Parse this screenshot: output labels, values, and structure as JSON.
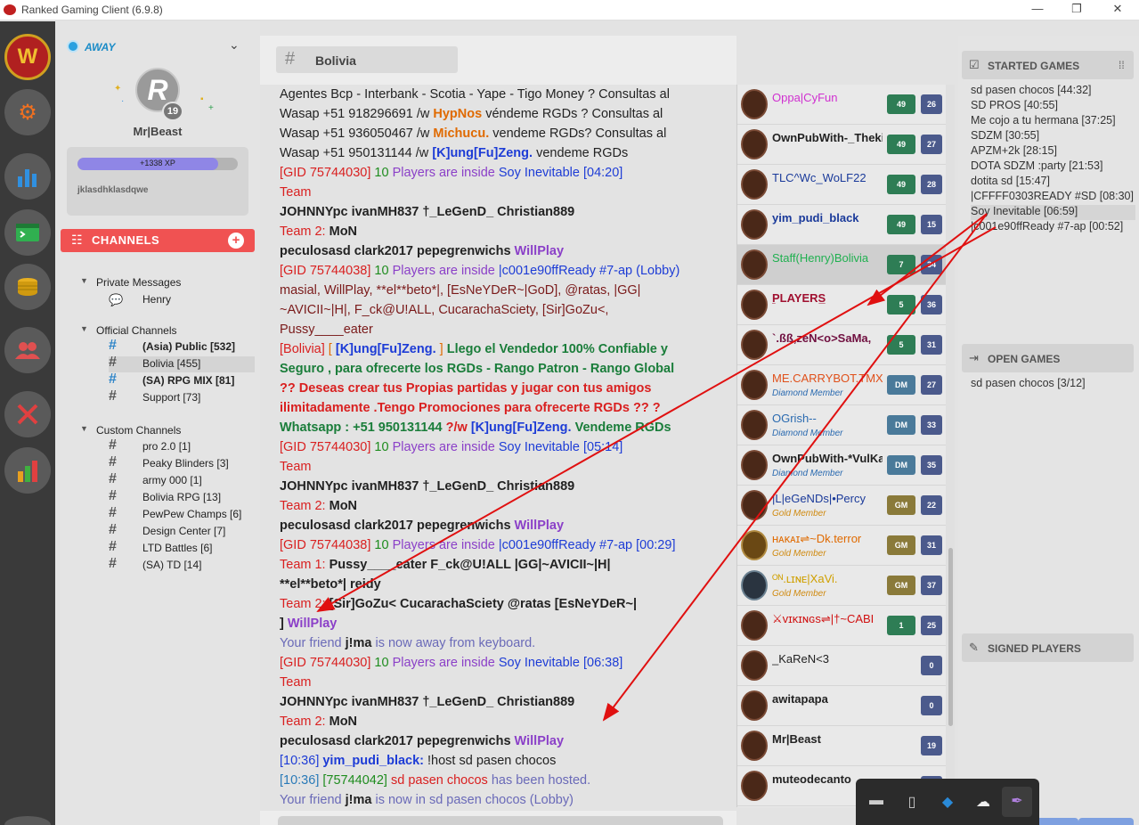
{
  "window": {
    "title": "Ranked Gaming Client (6.9.8)",
    "controls": [
      "—",
      "❐",
      "✕"
    ]
  },
  "rail": {
    "items": [
      {
        "name": "warcraft-logo",
        "glyph": "W"
      },
      {
        "name": "settings",
        "glyph": "⚙"
      },
      {
        "name": "stats",
        "glyph": "▮"
      },
      {
        "name": "console",
        "glyph": "▣"
      },
      {
        "name": "coins",
        "glyph": "◉"
      },
      {
        "name": "friends",
        "glyph": "👥"
      },
      {
        "name": "battle",
        "glyph": "⚔"
      },
      {
        "name": "ladder",
        "glyph": "▮"
      }
    ]
  },
  "profile": {
    "status": "AWAY",
    "avatar_letter": "R",
    "level": "19",
    "username": "Mr|Beast",
    "xp_label": "+1338 XP",
    "xp_progress": 0.88,
    "note": "jklasdhklasdqwe"
  },
  "channels": {
    "header": "CHANNELS",
    "groups": [
      {
        "label": "Private Messages",
        "items": [
          {
            "label": "Henry",
            "icon": "chat-bubble-icon"
          }
        ]
      },
      {
        "label": "Official Channels",
        "items": [
          {
            "label": "(Asia) Public [532]",
            "bold": true
          },
          {
            "label": "Bolivia [455]",
            "selected": true
          },
          {
            "label": "(SA) RPG MIX [81]",
            "bold": true
          },
          {
            "label": "Support [73]"
          }
        ]
      },
      {
        "label": "Custom Channels",
        "items": [
          {
            "label": "pro 2.0 [1]"
          },
          {
            "label": "Peaky Blinders [3]"
          },
          {
            "label": "army 000 [1]"
          },
          {
            "label": "Bolivia RPG [13]"
          },
          {
            "label": "PewPew Champs [6]"
          },
          {
            "label": "Design Center [7]"
          },
          {
            "label": "LTD Battles [6]"
          },
          {
            "label": "(SA) TD [14]"
          }
        ]
      }
    ]
  },
  "chat": {
    "tab": "Bolivia",
    "lines": [
      [
        [
          "bk",
          "",
          "Agentes Bcp - Interbank - Scotia - Yape - Tigo Money ? Consultas al"
        ]
      ],
      [
        [
          "bk",
          "",
          "Wasap +51 918296691 /w "
        ],
        [
          "or",
          "b",
          "HypNos"
        ],
        [
          "bk",
          "",
          " véndeme RGDs ? Consultas al"
        ]
      ],
      [
        [
          "bk",
          "",
          "Wasap +51 936050467 /w "
        ],
        [
          "or",
          "b",
          "Michucu."
        ],
        [
          "bk",
          "",
          " vendeme RGDs? Consultas al"
        ]
      ],
      [
        [
          "bk",
          "",
          "Wasap +51 950131144 /w "
        ],
        [
          "bl",
          "b",
          "[K]ung[Fu]Zeng."
        ],
        [
          "bk",
          "",
          " vendeme RGDs"
        ]
      ],
      [
        [
          "rd",
          "",
          "[GID 75744030]"
        ],
        [
          "gr",
          "",
          " 10"
        ],
        [
          "pu",
          "",
          " Players are inside"
        ],
        [
          "bl",
          "",
          " Soy Inevitable [04:20]"
        ]
      ],
      [
        [
          "rd",
          "",
          "Team"
        ]
      ],
      [
        [
          "bk",
          "b",
          "   JOHNNYpc    ivanMH837    †_LeGenD_    Christian889"
        ]
      ],
      [
        [
          "rd",
          "",
          "Team 2:"
        ],
        [
          "bk",
          "b",
          "   MoN"
        ]
      ],
      [
        [
          "bk",
          "b",
          "peculosasd   clark2017   pepegrenwichs"
        ],
        [
          "pu",
          "b",
          "   WillPlay"
        ]
      ],
      [
        [
          "rd",
          "",
          "[GID 75744038]"
        ],
        [
          "gr",
          "",
          " 10"
        ],
        [
          "pu",
          "",
          " Players are inside"
        ],
        [
          "bl",
          "",
          " |c001e90ffReady #7-ap (Lobby)"
        ]
      ],
      [
        [
          "dk",
          "",
          "masial, WillPlay, **el**beto*|, [EsNeYDeR~|GoD], @ratas, |GG|"
        ]
      ],
      [
        [
          "dk",
          "",
          "~AVICII~|H|, F_ck@U!ALL, CucarachaSciety, [Sir]GoZu<,"
        ]
      ],
      [
        [
          "dk",
          "",
          "Pussy____eater"
        ]
      ],
      [
        [
          "rd",
          "",
          "[Bolivia]"
        ],
        [
          "or",
          "",
          " [ "
        ],
        [
          "bl",
          "b",
          "[K]ung[Fu]Zeng."
        ],
        [
          "or",
          "",
          " ]"
        ],
        [
          "gb",
          "b",
          " Llego el Vendedor 100% Confiable y"
        ]
      ],
      [
        [
          "gb",
          "b",
          "Seguro , para ofrecerte los RGDs - Rango Patron - Rango Global"
        ]
      ],
      [
        [
          "rd",
          "b",
          "?? Deseas crear tus Propias partidas y jugar con tus amigos"
        ]
      ],
      [
        [
          "rd",
          "b",
          "ilimitadamente .Tengo Promociones para ofrecerte RGDs ?? ?"
        ]
      ],
      [
        [
          "gb",
          "b",
          "Whatsapp : +51 950131144"
        ],
        [
          "rd",
          "b",
          " ?/w "
        ],
        [
          "bl",
          "b",
          "[K]ung[Fu]Zeng."
        ],
        [
          "gb",
          "b",
          " Vendeme RGDs"
        ]
      ],
      [
        [
          "rd",
          "",
          "[GID 75744030]"
        ],
        [
          "gr",
          "",
          " 10"
        ],
        [
          "pu",
          "",
          " Players are inside"
        ],
        [
          "bl",
          "",
          " Soy Inevitable [05:14]"
        ]
      ],
      [
        [
          "rd",
          "",
          "Team"
        ]
      ],
      [
        [
          "bk",
          "b",
          "   JOHNNYpc    ivanMH837    †_LeGenD_    Christian889"
        ]
      ],
      [
        [
          "rd",
          "",
          "Team 2:"
        ],
        [
          "bk",
          "b",
          "   MoN"
        ]
      ],
      [
        [
          "bk",
          "b",
          "peculosasd   clark2017   pepegrenwichs"
        ],
        [
          "pu",
          "b",
          "   WillPlay"
        ]
      ],
      [
        [
          "rd",
          "",
          "[GID 75744038]"
        ],
        [
          "gr",
          "",
          " 10"
        ],
        [
          "pu",
          "",
          " Players are inside"
        ],
        [
          "bl",
          "",
          " |c001e90ffReady #7-ap [00:29]"
        ]
      ],
      [
        [
          "rd",
          "",
          "Team 1:"
        ],
        [
          "bk",
          "b",
          "   Pussy____eater    F_ck@U!ALL    |GG|~AVICII~|H|"
        ]
      ],
      [
        [
          "bk",
          "b",
          "**el**beto*|    reidy"
        ]
      ],
      [
        [
          "rd",
          "",
          "Team 2:"
        ],
        [
          "bk",
          "b",
          "   [Sir]GoZu<    CucarachaSciety    @ratas    [EsNeYDeR~|"
        ]
      ],
      [
        [
          "bk",
          "b",
          "]"
        ],
        [
          "pu",
          "b",
          "   WillPlay"
        ]
      ],
      [
        [
          "fb",
          "",
          "Your friend "
        ],
        [
          "bk",
          "b",
          "j!ma"
        ],
        [
          "fb",
          "",
          " is now away from keyboard."
        ]
      ],
      [
        [
          "rd",
          "",
          "[GID 75744030]"
        ],
        [
          "gr",
          "",
          " 10"
        ],
        [
          "pu",
          "",
          " Players are inside"
        ],
        [
          "bl",
          "",
          " Soy Inevitable [06:38]"
        ]
      ],
      [
        [
          "rd",
          "",
          "Team"
        ]
      ],
      [
        [
          "bk",
          "b",
          "   JOHNNYpc    ivanMH837    †_LeGenD_    Christian889"
        ]
      ],
      [
        [
          "rd",
          "",
          "Team 2:"
        ],
        [
          "bk",
          "b",
          "   MoN"
        ]
      ],
      [
        [
          "bk",
          "b",
          "peculosasd   clark2017   pepegrenwichs"
        ],
        [
          "pu",
          "b",
          "   WillPlay"
        ]
      ],
      [
        [
          "bl",
          "",
          "[10:36]"
        ],
        [
          "bl",
          "b",
          " yim_pudi_black:"
        ],
        [
          "bk",
          "",
          " !host sd pasen chocos"
        ]
      ],
      [
        [
          "tl",
          "",
          "[10:36]"
        ],
        [
          "gr",
          "",
          " [75744042]"
        ],
        [
          "rd",
          "",
          " sd pasen chocos"
        ],
        [
          "fb",
          "",
          " has been hosted."
        ]
      ],
      [
        [
          "fb",
          "",
          "Your friend "
        ],
        [
          "bk",
          "b",
          "j!ma"
        ],
        [
          "fb",
          "",
          " is now in sd pasen chocos (Lobby)"
        ]
      ]
    ]
  },
  "users": [
    {
      "name": "Oppa|CyFun",
      "color": "#d030d0",
      "bold": false,
      "badge": "49",
      "badge_color": "#2e7d55",
      "count": "26"
    },
    {
      "name": "OwnPubWith-_Theki",
      "color": "#222",
      "bold": true,
      "badge": "49",
      "badge_color": "#2e7d55",
      "count": "27"
    },
    {
      "name": "TLC^Wc_WoLF22",
      "color": "#1a3a9a",
      "bold": false,
      "badge": "49",
      "badge_color": "#2e7d55",
      "count": "28"
    },
    {
      "name": "yim_pudi_black",
      "color": "#1a3a9a",
      "bold": true,
      "badge": "49",
      "badge_color": "#2e7d55",
      "count": "15"
    },
    {
      "name": "Staff(Henry)Boliviа",
      "color": "#20b050",
      "bold": false,
      "badge": "7",
      "badge_color": "#2e7d55",
      "count": "34",
      "selected": true
    },
    {
      "name": "̲PLAYERS̲",
      "color": "#a01030",
      "bold": true,
      "badge": "5",
      "badge_color": "#2e7d55",
      "count": "36"
    },
    {
      "name": "`.ßß,zeN<o>SaMa,",
      "color": "#701040",
      "bold": true,
      "badge": "5",
      "badge_color": "#2e7d55",
      "count": "31"
    },
    {
      "name": "ME.CARRYBOT.TMX",
      "color": "#e0501a",
      "bold": false,
      "sub": "Diamond Member",
      "sub_color": "#2a6ab0",
      "badge": "DM",
      "badge_color": "#4a7a9a",
      "count": "27"
    },
    {
      "name": "OGrish--",
      "color": "#2a6ab0",
      "bold": false,
      "sub": "Diamond Member",
      "sub_color": "#2a6ab0",
      "badge": "DM",
      "badge_color": "#4a7a9a",
      "count": "33"
    },
    {
      "name": "OwnPubWith-*VulKa",
      "color": "#222",
      "bold": true,
      "sub": "Diamond Member",
      "sub_color": "#2a6ab0",
      "badge": "DM",
      "badge_color": "#4a7a9a",
      "count": "35"
    },
    {
      "name": "|L|eGeNDs|•Percy",
      "color": "#1a3a9a",
      "bold": false,
      "sub": "Gold Member",
      "sub_color": "#d08a10",
      "badge": "GM",
      "badge_color": "#8a7a3a",
      "count": "22"
    },
    {
      "name": "ʜᴀᴋᴀɪ⇌~Dk.terror",
      "color": "#e06a00",
      "bold": false,
      "sub": "Gold Member",
      "sub_color": "#d08a10",
      "badge": "GM",
      "badge_color": "#8a7a3a",
      "count": "31",
      "emblem": "gold"
    },
    {
      "name": "ᴼᴺ.ʟɪɴᴇ|XaVi.",
      "color": "#d0a000",
      "bold": false,
      "sub": "Gold Member",
      "sub_color": "#d08a10",
      "badge": "GM",
      "badge_color": "#8a7a3a",
      "count": "37",
      "emblem": "ice"
    },
    {
      "name": "⚔ᴠɪᴋɪɴɢs⇌|†~CABI",
      "color": "#d01010",
      "bold": false,
      "badge": "1",
      "badge_color": "#2e7d55",
      "count": "25"
    },
    {
      "name": "_KaReN<3",
      "color": "#222",
      "bold": false,
      "count": "0"
    },
    {
      "name": "awitapapa",
      "color": "#222",
      "bold": true,
      "count": "0"
    },
    {
      "name": "Mr|Beast",
      "color": "#222",
      "bold": true,
      "count": "19"
    },
    {
      "name": "muteodecanto",
      "color": "#222",
      "bold": true,
      "count": ""
    }
  ],
  "started_games": {
    "title": "STARTED GAMES",
    "items": [
      "sd pasen chocos [44:32]",
      "SD PROS [40:55]",
      "Me cojo a tu hermana [37:25]",
      "SDZM [30:55]",
      "APZM+2k [28:15]",
      "DOTA SDZM :party [21:53]",
      "dotita sd [15:47]",
      "|CFFFF0303READY #SD [08:30]",
      "Soy Inevitable [06:59]",
      "|c001e90ffReady #7-ap [00:52]"
    ],
    "selected_index": 8
  },
  "open_games": {
    "title": "OPEN GAMES",
    "items": [
      "sd pasen chocos [3/12]"
    ]
  },
  "signed_players": {
    "title": "SIGNED PLAYERS"
  },
  "taskbar": {
    "icons": [
      "folder-icon",
      "usb-icon",
      "shield-icon",
      "cloud-icon",
      "feather-icon"
    ]
  },
  "colors": {
    "channels_header": "#f05252",
    "annotation_arrow": "#e01010",
    "status_away": "#2aa1e0"
  }
}
